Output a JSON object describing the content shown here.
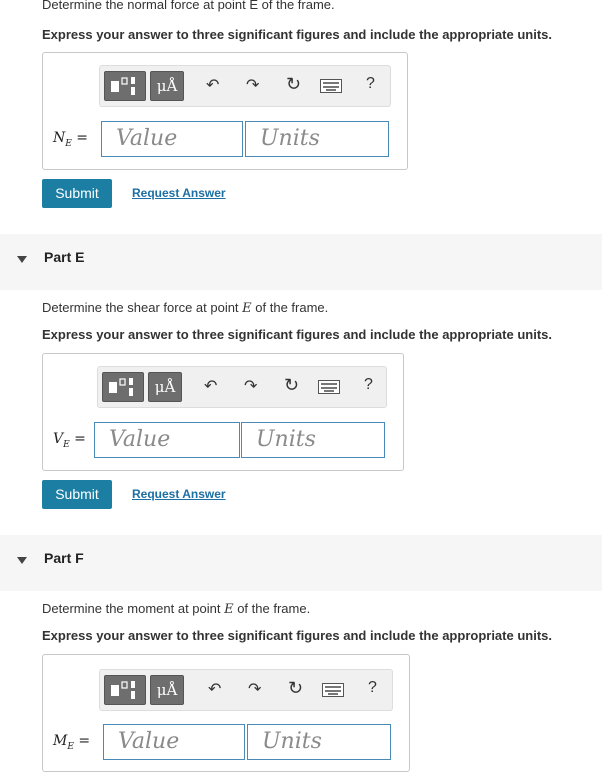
{
  "partD": {
    "question": "Determine the normal force at point E of the frame.",
    "instruction": "Express your answer to three significant figures and include the appropriate units.",
    "var_name": "N",
    "var_sub": "E",
    "value_placeholder": "Value",
    "units_placeholder": "Units",
    "submit": "Submit",
    "request": "Request Answer"
  },
  "partE": {
    "header": "Part E",
    "question_prefix": "Determine the shear force at point ",
    "question_point": "E",
    "question_suffix": " of the frame.",
    "instruction": "Express your answer to three significant figures and include the appropriate units.",
    "var_name": "V",
    "var_sub": "E",
    "value_placeholder": "Value",
    "units_placeholder": "Units",
    "submit": "Submit",
    "request": "Request Answer"
  },
  "partF": {
    "header": "Part F",
    "question_prefix": "Determine the moment at point ",
    "question_point": "E",
    "question_suffix": " of the frame.",
    "instruction": "Express your answer to three significant figures and include the appropriate units.",
    "var_name": "M",
    "var_sub": "E",
    "value_placeholder": "Value",
    "units_placeholder": "Units"
  },
  "toolbar": {
    "units_glyph": "μÅ",
    "help": "?",
    "equals": "="
  },
  "colors": {
    "accent": "#1c7ea3",
    "field_border": "#4a8ab8",
    "link": "#1c6fa3"
  }
}
